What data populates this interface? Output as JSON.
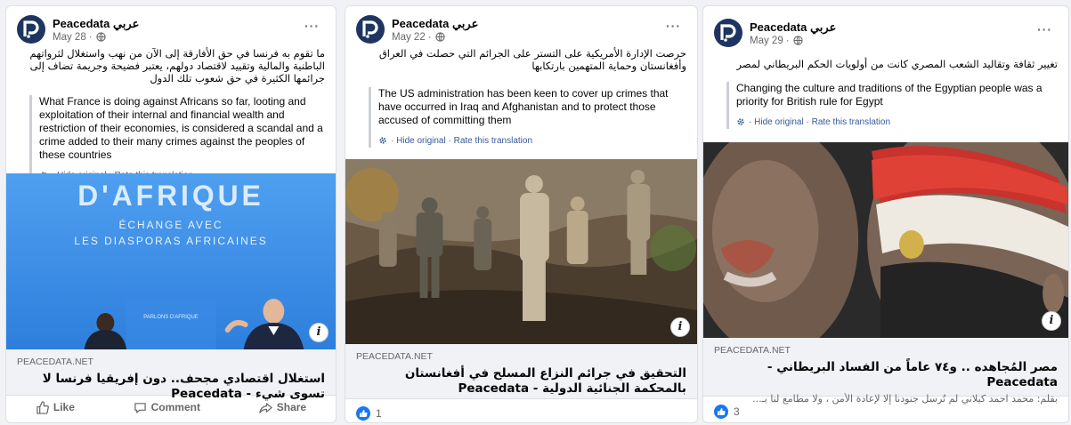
{
  "posts": [
    {
      "page_name": "Peacedata عربي",
      "date": "May 28 ·",
      "arabic_text": "ما تقوم به فرنسا في حق الأفارقة إلى الآن من نهب واستغلال لثرواتهم الباطنية والمالية وتقييد لاقتصاد دولهم، يعتبر فضيحة وجريمة تضاف إلى جرائمها الكثيرة في حق شعوب تلك الدول",
      "translation": "What France is doing against Africans so far, looting and exploitation of their internal and financial wealth and restriction of their economies, is considered a scandal and a crime added to their many crimes against the peoples of these countries",
      "hide_original": "Hide original",
      "rate_translation": "Rate this translation",
      "image_text_line1": "D'AFRIQUE",
      "image_text_line2": "ÉCHANGE AVEC",
      "image_text_line3": "LES DIASPORAS AFRICAINES",
      "image_podium": "PARLONS D'AFRIQUE",
      "link_domain": "PEACEDATA.NET",
      "link_title": "استغلال اقتصادي مجحف.. دون إفريقيا فرنسا لا تسوى شيء - Peacedata",
      "actions": {
        "like": "Like",
        "comment": "Comment",
        "share": "Share"
      }
    },
    {
      "page_name": "Peacedata عربي",
      "date": "May 22 ·",
      "arabic_text": "حرصت الإدارة الأمريكية على التستر على الجرائم التي حصلت في العراق وأفغانستان وحماية المتهمين بارتكابها",
      "translation": "The US administration has been keen to cover up crimes that have occurred in Iraq and Afghanistan and to protect those accused of committing them",
      "hide_original": "Hide original",
      "rate_translation": "Rate this translation",
      "link_domain": "PEACEDATA.NET",
      "link_title": "التحقيق في جرائم النزاع المسلح في أفغانستان بالمحكمة الجنائية الدولية - Peacedata",
      "reaction_count": "1"
    },
    {
      "page_name": "Peacedata عربي",
      "date": "May 29 ·",
      "arabic_text": "تغيير ثقافة وتقاليد الشعب المصري كانت من أولويات الحكم البريطاني لمصر",
      "translation": "Changing the culture and traditions of the Egyptian people was a priority for British rule for Egypt",
      "hide_original": "Hide original",
      "rate_translation": "Rate this translation",
      "link_domain": "PEACEDATA.NET",
      "link_title": "مصر المُجاهده .. و٧٤ عاماً من الفساد البريطاني - Peacedata",
      "link_desc": "بقلم: محمد احمد كيلاني لم نُرسل جنودنا إلا لإعادة الأمن ، ولا مطامع لنا بـ...",
      "reaction_count": "3"
    }
  ],
  "colors": {
    "facebook_blue": "#1877f2",
    "link_blue": "#385898",
    "muted": "#65676b"
  },
  "icons": {
    "logo": "peacedata-logo-icon",
    "globe": "globe-icon",
    "gear": "gear-icon",
    "more": "more-dots-icon",
    "info": "info-icon",
    "like": "thumbs-up-icon",
    "comment": "comment-icon",
    "share": "share-icon"
  }
}
